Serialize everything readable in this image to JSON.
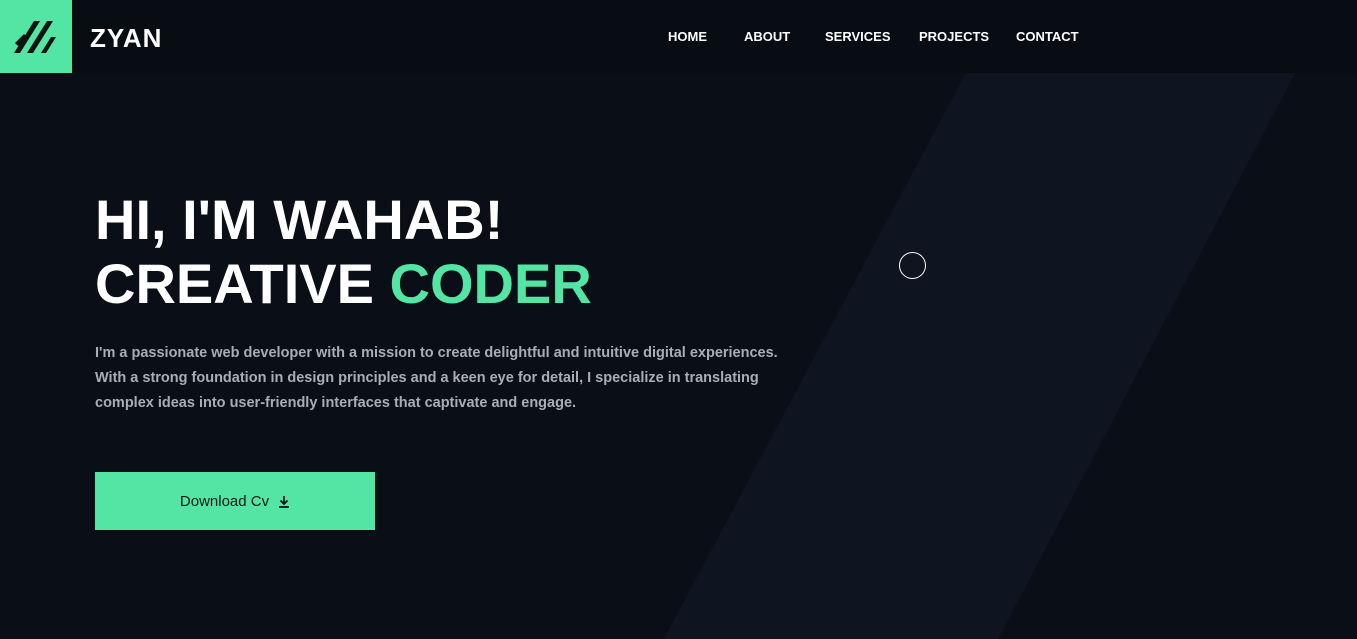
{
  "header": {
    "brand": "ZYAN",
    "logo_icon": "slashes-logo-icon",
    "nav": [
      {
        "label": "HOME"
      },
      {
        "label": "ABOUT"
      },
      {
        "label": "SERVICES"
      },
      {
        "label": "PROJECTS"
      },
      {
        "label": "CONTACT"
      }
    ]
  },
  "hero": {
    "line1": "HI, I'M WAHAB!",
    "line2_prefix": "CREATIVE ",
    "line2_accent": "CODER",
    "description": "I'm a passionate web developer with a mission to create delightful and intuitive digital experiences. With a strong foundation in design principles and a keen eye for detail, I specialize in translating complex ideas into user-friendly interfaces that captivate and engage.",
    "cta_label": "Download Cv",
    "cta_icon": "download-icon"
  },
  "colors": {
    "background": "#0a0e17",
    "header_background": "#080d14",
    "accent": "#52e5a4",
    "text": "#ffffff",
    "muted_text": "#a9aeb6",
    "decorative_shape": "#0f1520"
  }
}
